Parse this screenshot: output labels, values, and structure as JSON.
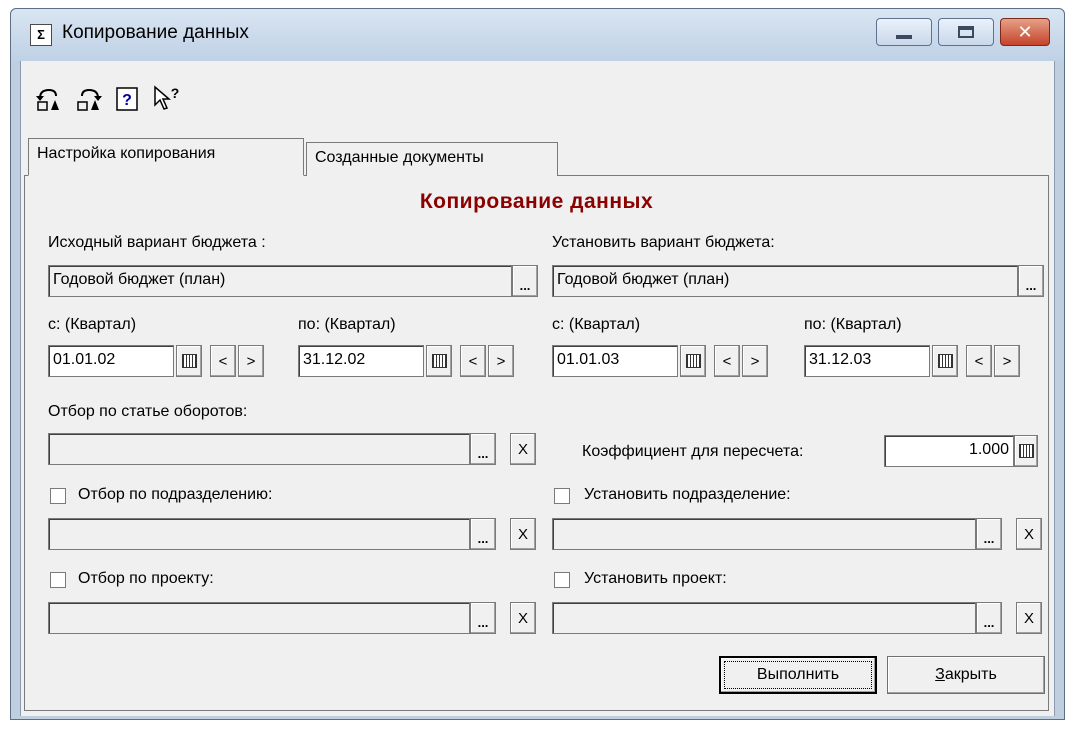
{
  "window": {
    "title": "Копирование данных",
    "app_icon_text": "Σ"
  },
  "toolbar": {
    "icons": [
      "undo-icon",
      "redo-icon",
      "help-icon",
      "whats-this-icon"
    ]
  },
  "tabs": [
    {
      "label": "Настройка копирования",
      "active": true
    },
    {
      "label": "Созданные документы",
      "active": false
    }
  ],
  "form": {
    "heading": "Копирование данных",
    "source_label": "Исходный вариант бюджета :",
    "source_value": "Годовой бюджет (план)",
    "target_label": "Установить вариант бюджета:",
    "target_value": "Годовой бюджет (план)",
    "period_from_label": "с: (Квартал)",
    "period_to_label": "по: (Квартал)",
    "source_from": "01.01.02",
    "source_to": "31.12.02",
    "target_from": "01.01.03",
    "target_to": "31.12.03",
    "ellipsis": "...",
    "prev": "<",
    "next": ">",
    "clear": "X",
    "turnover_label": "Отбор по статье оборотов:",
    "turnover_value": "",
    "coef_label": "Коэффициент для пересчета:",
    "coef_value": "1.000",
    "division_filter_label": "Отбор по подразделению:",
    "division_filter_checked": false,
    "set_division_label": "Установить подразделение:",
    "set_division_checked": false,
    "project_filter_label": "Отбор по проекту:",
    "project_filter_checked": false,
    "set_project_label": "Установить проект:",
    "set_project_checked": false
  },
  "buttons": {
    "execute": "Выполнить",
    "close_first": "З",
    "close_rest": "акрыть"
  },
  "colors": {
    "heading": "#8b0000",
    "face": "#f0f0f0",
    "frame": "#bfcfe0"
  }
}
